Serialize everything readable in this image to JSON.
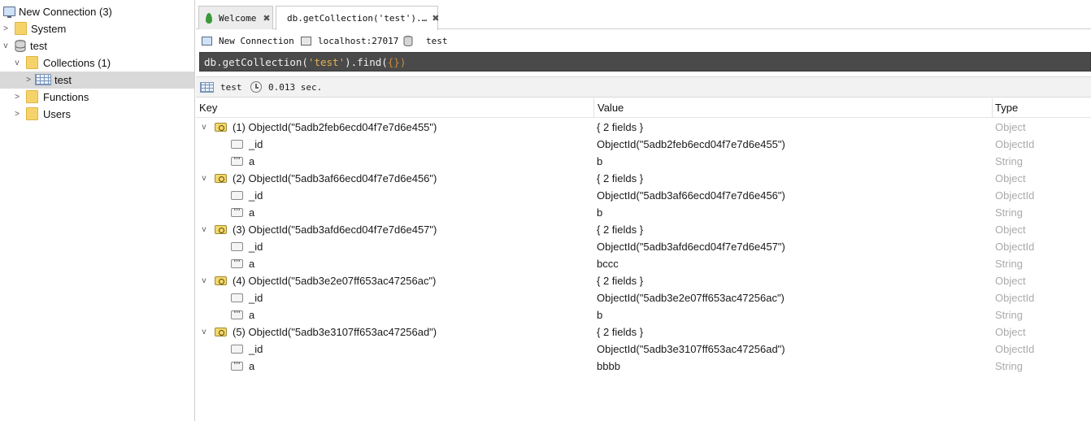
{
  "sidebar": {
    "connection": "New Connection (3)",
    "system": "System",
    "database": "test",
    "collections": "Collections (1)",
    "collection_item": "test",
    "functions": "Functions",
    "users": "Users"
  },
  "tabs": [
    {
      "label": "Welcome",
      "close": "✖"
    },
    {
      "label": "db.getCollection('test').…",
      "close": "✖"
    }
  ],
  "info": {
    "connection": "New Connection",
    "server": "localhost:27017",
    "database": "test"
  },
  "query": {
    "prefix": "db.getCollection(",
    "arg": "'test'",
    "mid": ").find(",
    "braces": "{}",
    "suffix": ")"
  },
  "status": {
    "collection": "test",
    "time": "0.013 sec."
  },
  "grid": {
    "headers": {
      "key": "Key",
      "value": "Value",
      "type": "Type"
    },
    "documents": [
      {
        "key": "(1) ObjectId(\"5adb2feb6ecd04f7e7d6e455\")",
        "value": "{ 2 fields }",
        "type": "Object",
        "fields": [
          {
            "key": "_id",
            "value": "ObjectId(\"5adb2feb6ecd04f7e7d6e455\")",
            "type": "ObjectId"
          },
          {
            "key": "a",
            "value": "b",
            "type": "String"
          }
        ]
      },
      {
        "key": "(2) ObjectId(\"5adb3af66ecd04f7e7d6e456\")",
        "value": "{ 2 fields }",
        "type": "Object",
        "fields": [
          {
            "key": "_id",
            "value": "ObjectId(\"5adb3af66ecd04f7e7d6e456\")",
            "type": "ObjectId"
          },
          {
            "key": "a",
            "value": "b",
            "type": "String"
          }
        ]
      },
      {
        "key": "(3) ObjectId(\"5adb3afd6ecd04f7e7d6e457\")",
        "value": "{ 2 fields }",
        "type": "Object",
        "fields": [
          {
            "key": "_id",
            "value": "ObjectId(\"5adb3afd6ecd04f7e7d6e457\")",
            "type": "ObjectId"
          },
          {
            "key": "a",
            "value": "bccc",
            "type": "String"
          }
        ]
      },
      {
        "key": "(4) ObjectId(\"5adb3e2e07ff653ac47256ac\")",
        "value": "{ 2 fields }",
        "type": "Object",
        "fields": [
          {
            "key": "_id",
            "value": "ObjectId(\"5adb3e2e07ff653ac47256ac\")",
            "type": "ObjectId"
          },
          {
            "key": "a",
            "value": "b",
            "type": "String"
          }
        ]
      },
      {
        "key": "(5) ObjectId(\"5adb3e3107ff653ac47256ad\")",
        "value": "{ 2 fields }",
        "type": "Object",
        "fields": [
          {
            "key": "_id",
            "value": "ObjectId(\"5adb3e3107ff653ac47256ad\")",
            "type": "ObjectId"
          },
          {
            "key": "a",
            "value": "bbbb",
            "type": "String"
          }
        ]
      }
    ]
  }
}
